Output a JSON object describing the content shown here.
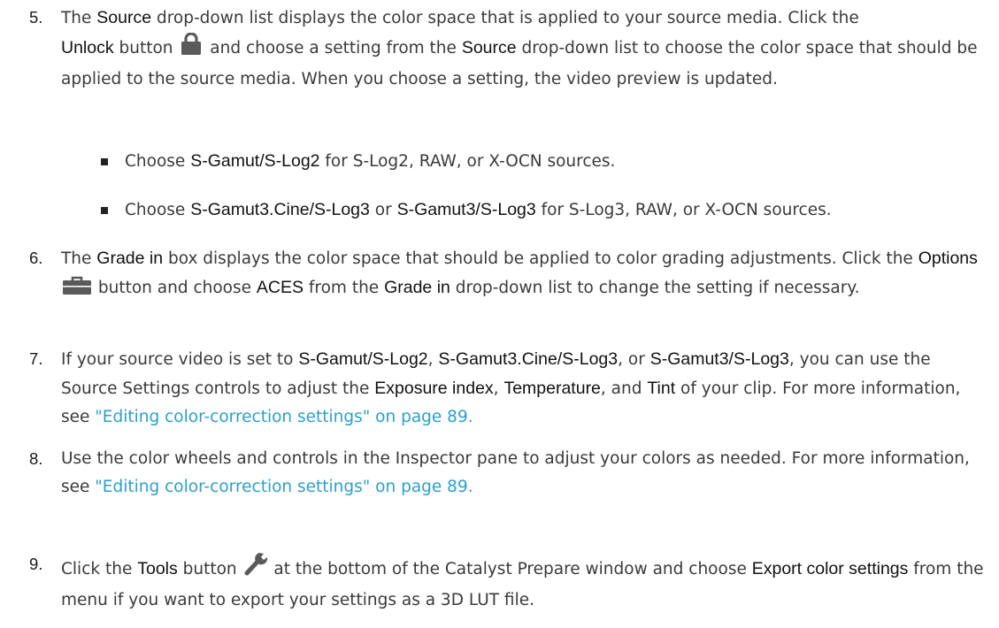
{
  "steps": [
    {
      "number": "5.",
      "p1": "The ",
      "b1": "Source",
      "p2": " drop-down list displays the color space that is applied to your source media. Click the ",
      "b2": "Unlock",
      "p3": " button ",
      "icon": "lock-icon",
      "p4": " and choose a setting from the ",
      "b3": "Source",
      "p5": " drop-down list to choose the color space that should be applied to the source media. When you choose a setting, the video preview is updated."
    },
    {
      "number": "6.",
      "p1": "The ",
      "b1": "Grade in",
      "p2": " box displays the color space that should be applied to color grading adjustments. Click the ",
      "b2": "Options",
      "icon": "toolbox-icon",
      "p3": " button and choose ",
      "b3": "ACES",
      "p4": " from the ",
      "b4": "Grade in",
      "p5": " drop-down list to change the setting if necessary."
    },
    {
      "number": "7.",
      "p1": "If your source video is set to ",
      "b1": "S-Gamut/S-Log2",
      "p2": ", ",
      "b2": "S-Gamut3.Cine/S-Log3",
      "p3": ", or ",
      "b3": "S-Gamut3/S-Log3",
      "p4": ", you can use the Source Settings controls to adjust the ",
      "b4": "Exposure index",
      "p5": ", ",
      "b5": "Temperature",
      "p6": ", and ",
      "b6": "Tint",
      "p7": " of your clip. For more information, see ",
      "link": "\"Editing color-correction settings\" on page 89.",
      "p8": ""
    },
    {
      "number": "8.",
      "p1": "Use the color wheels and controls in the Inspector pane to adjust your colors as needed. For more information, see ",
      "link": "\"Editing color-correction settings\" on page 89."
    },
    {
      "number": "9.",
      "p1": "Click the ",
      "b1": "Tools",
      "p2": " button ",
      "icon": "wrench-icon",
      "p3": " at the bottom of the Catalyst Prepare window and choose ",
      "b2": "Export color settings",
      "p4": " from the menu if you want to export your settings as a 3D LUT file."
    }
  ],
  "bullets": [
    {
      "p1": "Choose ",
      "b1": "S-Gamut/S-Log2",
      "p2": " for S-Log2, RAW, or X-OCN sources."
    },
    {
      "p1": "Choose ",
      "b1": "S-Gamut3.Cine/S-Log3",
      "p2": " or ",
      "b2": "S-Gamut3/S-Log3",
      "p3": " for S-Log3, RAW, or X-OCN sources."
    }
  ]
}
